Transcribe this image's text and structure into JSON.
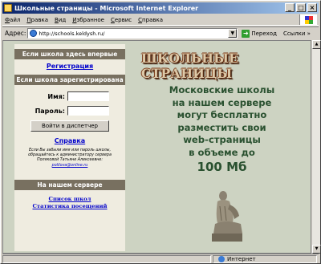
{
  "window": {
    "title": "Школьные страницы - Microsoft Internet Explorer",
    "controls": [
      "_",
      "□",
      "×"
    ]
  },
  "menu": {
    "items": [
      {
        "underlined": "Ф",
        "rest": "айл"
      },
      {
        "underlined": "П",
        "rest": "равка"
      },
      {
        "underlined": "В",
        "rest": "ид"
      },
      {
        "underlined": "И",
        "rest": "збранное"
      },
      {
        "underlined": "С",
        "rest": "ервис"
      },
      {
        "underlined": "С",
        "rest": "правка"
      }
    ]
  },
  "address_bar": {
    "label": "Адрес:",
    "url": "http://schools.keldysh.ru/",
    "go_label": "Переход",
    "links_label": "Ссылки »"
  },
  "sidebar": {
    "first_time_heading": "Если школа здесь впервые",
    "register_link": "Регистрация",
    "registered_heading": "Если школа зарегистрирована",
    "login_label": "Имя:",
    "password_label": "Пароль:",
    "login_value": "",
    "password_value": "",
    "submit_label": "Войти в диспетчер",
    "help_link": "Справка",
    "note_text": "Если Вы забыли имя или пароль школы, обращайтесь к администратору сервера Поляковой Татьяне Алексеевне:",
    "note_email": "polilova@online.ru",
    "server_heading": "На нашем сервере",
    "schools_list_link": "Список школ",
    "visits_link": "Статистика посещений"
  },
  "main": {
    "logo_text": "ШКОЛЬНЫЕ СТРАНИЦЫ",
    "promo_lines": [
      "Московские школы",
      "на нашем сервере",
      "могут  бесплатно",
      "разместить свои",
      "web-страницы",
      "в объеме до"
    ],
    "promo_big": "100 Мб"
  },
  "statusbar": {
    "zone": "Интернет"
  },
  "colors": {
    "page_bg": "#cdd3c2",
    "sidebar_bg": "#efece0",
    "heading_bg": "#787060",
    "promo_text": "#2a5130",
    "link": "#0000cc"
  }
}
